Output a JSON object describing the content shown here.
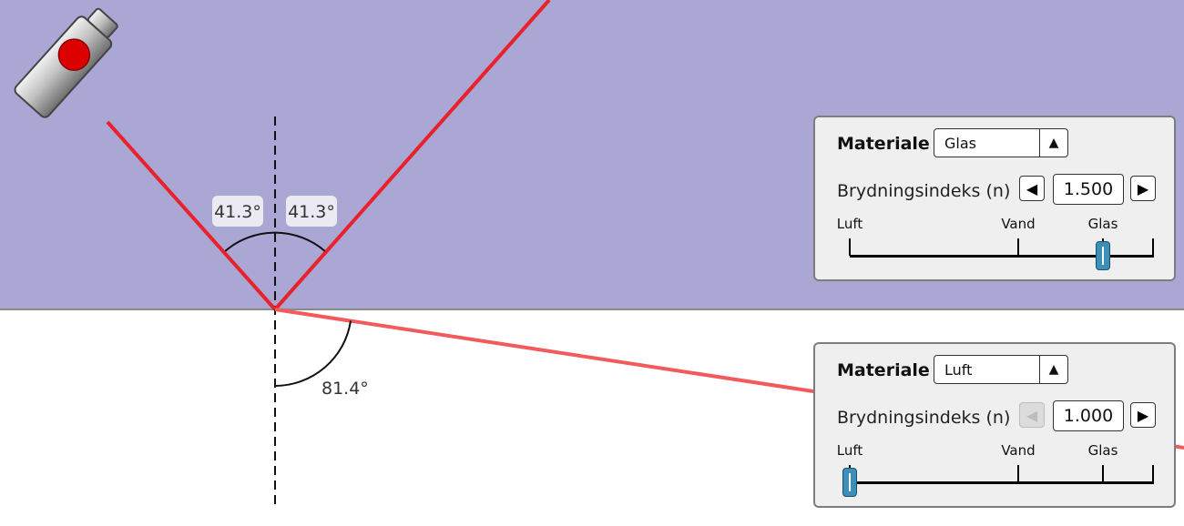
{
  "scene": {
    "colors": {
      "upper_medium": "#aaa7d5",
      "lower_medium": "#ffffff",
      "incident_ray": "#e8212b",
      "reflected_ray": "#e8212b",
      "refracted_ray": "#f25a5c",
      "laser_button": "#dd0000"
    },
    "angles": {
      "incidence": "41.3°",
      "reflection": "41.3°",
      "refraction": "81.4°"
    }
  },
  "panels": {
    "top": {
      "title": "Materiale",
      "material": "Glas",
      "combo_icon": "triangle-up-icon",
      "index_label": "Brydningsindeks (n)",
      "index_value": "1.500",
      "decrement_enabled": true,
      "slider_labels": [
        "Luft",
        "Vand",
        "Glas"
      ],
      "slider_value_n": 1.5
    },
    "bottom": {
      "title": "Materiale",
      "material": "Luft",
      "combo_icon": "triangle-up-icon",
      "index_label": "Brydningsindeks (n)",
      "index_value": "1.000",
      "decrement_enabled": false,
      "slider_labels": [
        "Luft",
        "Vand",
        "Glas"
      ],
      "slider_value_n": 1.0
    }
  }
}
